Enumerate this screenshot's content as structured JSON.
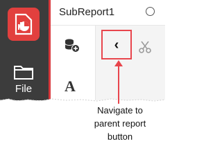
{
  "panel": {
    "title": "SubReport1"
  },
  "sidebar": {
    "file_label": "File"
  },
  "toolbar": {
    "font_icon_glyph": "A",
    "back_glyph": "‹"
  },
  "callout": {
    "lines": [
      "Navigate to",
      "parent report",
      "button"
    ]
  },
  "colors": {
    "accent": "#e2403e",
    "highlight": "#e8454c",
    "rail": "#3c3c3c"
  },
  "icons": [
    "report-logo-icon",
    "folder-icon",
    "add-data-source-icon",
    "font-icon",
    "chevron-left-icon",
    "cut-icon",
    "radio-icon"
  ]
}
